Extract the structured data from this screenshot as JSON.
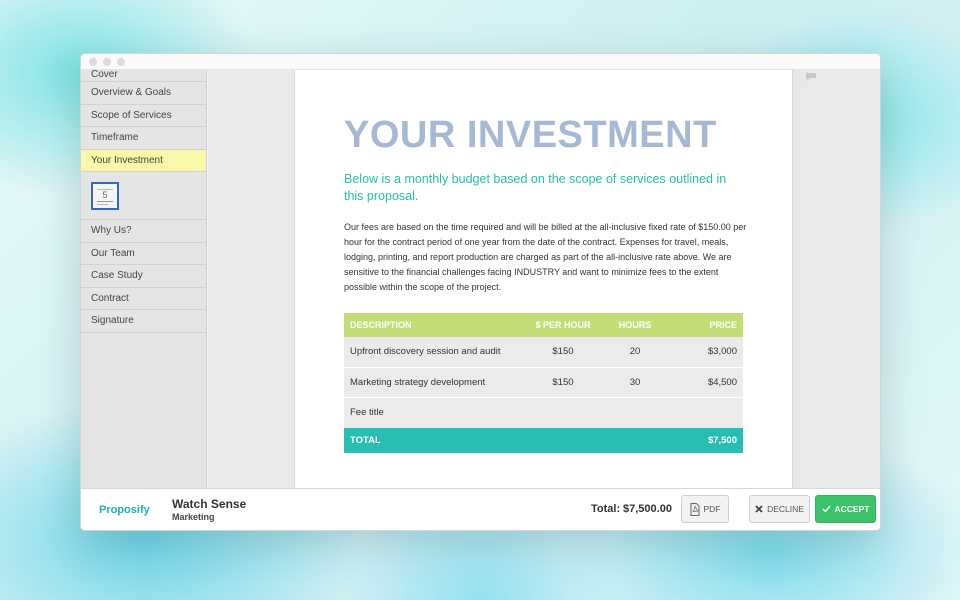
{
  "sidebar": {
    "items_top": [
      {
        "label": "Cover"
      },
      {
        "label": "Overview & Goals"
      },
      {
        "label": "Scope of Services"
      },
      {
        "label": "Timeframe"
      },
      {
        "label": "Your Investment"
      }
    ],
    "thumbnail_page": "5",
    "items_bottom": [
      {
        "label": "Why Us?"
      },
      {
        "label": "Our Team"
      },
      {
        "label": "Case Study"
      },
      {
        "label": "Contract"
      },
      {
        "label": "Signature"
      }
    ]
  },
  "page": {
    "title": "YOUR INVESTMENT",
    "subtitle": "Below is a monthly budget based on the scope of services outlined in this proposal.",
    "body": "Our fees are based on the time required and will be billed at the all-inclusive fixed rate of $150.00 per hour for the contract period of one year from the date of the contract. Expenses for travel, meals, lodging, printing, and report production are charged as part of the all-inclusive rate above. We are sensitive to the financial challenges facing INDUSTRY and want to minimize fees to the extent possible within the scope of the project.",
    "table": {
      "headers": [
        "DESCRIPTION",
        "$ PER HOUR",
        "HOURS",
        "PRICE"
      ],
      "rows": [
        [
          "Upfront discovery session and audit",
          "$150",
          "20",
          "$3,000"
        ],
        [
          "Marketing strategy development",
          "$150",
          "30",
          "$4,500"
        ],
        [
          "Fee title",
          "",
          "",
          ""
        ]
      ],
      "total_label": "TOTAL",
      "total_value": "$7,500"
    }
  },
  "footer": {
    "brand": "Proposify",
    "client_name": "Watch Sense",
    "client_subtitle": "Marketing",
    "total_label": "Total:",
    "total_value": "$7,500.00",
    "pdf_label": "PDF",
    "decline_label": "DECLINE",
    "accept_label": "ACCEPT"
  },
  "colors": {
    "accent_teal": "#27bdb0",
    "table_header_green": "#c4dd76",
    "title_blue": "#a6b9d4",
    "active_item_yellow": "#fbf7a8",
    "accept_green": "#3cc26b"
  },
  "icons": [
    "pdf-icon",
    "close-icon",
    "check-icon",
    "comment-icon"
  ]
}
